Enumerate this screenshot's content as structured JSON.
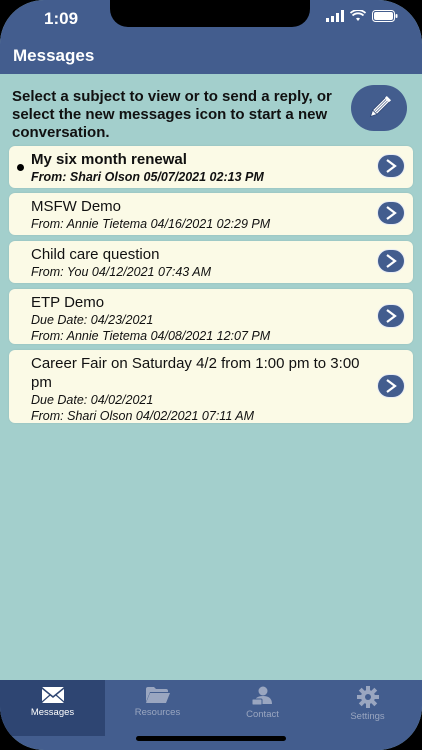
{
  "status_bar": {
    "time": "1:09"
  },
  "nav": {
    "title": "Messages"
  },
  "instructions": "Select a subject to view or to send a reply, or select the new messages icon to start a new conversation.",
  "new_message_icon": "pencil-icon",
  "messages": [
    {
      "subject": "My six month renewal",
      "due": "",
      "from": "From: Shari Olson 05/07/2021 02:13 PM",
      "unread": true
    },
    {
      "subject": "MSFW Demo",
      "due": "",
      "from": "From: Annie Tietema 04/16/2021 02:29 PM",
      "unread": false
    },
    {
      "subject": "Child care question",
      "due": "",
      "from": "From: You 04/12/2021 07:43 AM",
      "unread": false
    },
    {
      "subject": "ETP Demo",
      "due": "Due Date: 04/23/2021",
      "from": "From: Annie Tietema 04/08/2021 12:07 PM",
      "unread": false
    },
    {
      "subject": "Career Fair on Saturday 4/2 from 1:00 pm to 3:00 pm",
      "due": "Due Date: 04/02/2021",
      "from": "From: Shari Olson 04/02/2021 07:11 AM",
      "unread": false
    }
  ],
  "tabs": [
    {
      "label": "Messages",
      "icon": "envelope-icon",
      "active": true
    },
    {
      "label": "Resources",
      "icon": "folder-icon",
      "active": false
    },
    {
      "label": "Contact",
      "icon": "contact-card-icon",
      "active": false
    },
    {
      "label": "Settings",
      "icon": "gear-icon",
      "active": false
    }
  ],
  "colors": {
    "primary": "#435d8e",
    "background": "#a3cfcc",
    "card": "#fbfae6"
  }
}
